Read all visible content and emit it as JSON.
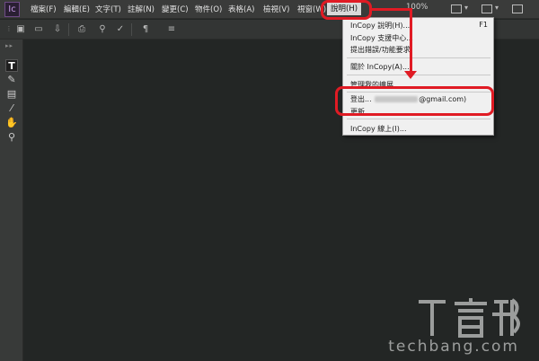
{
  "app": {
    "logo_text": "Ic"
  },
  "menubar": {
    "items": [
      {
        "label": "檔案(F)"
      },
      {
        "label": "編輯(E)"
      },
      {
        "label": "文字(T)"
      },
      {
        "label": "註解(N)"
      },
      {
        "label": "變更(C)"
      },
      {
        "label": "物件(O)"
      },
      {
        "label": "表格(A)"
      },
      {
        "label": "檢視(V)"
      },
      {
        "label": "視窗(W)"
      },
      {
        "label": "說明(H)"
      }
    ],
    "zoom": "100%"
  },
  "tools": [
    {
      "name": "type-tool-icon",
      "glyph": "T"
    },
    {
      "name": "note-tool-icon",
      "glyph": "✎"
    },
    {
      "name": "position-tool-icon",
      "glyph": "▤"
    },
    {
      "name": "eyedropper-tool-icon",
      "glyph": "⁄"
    },
    {
      "name": "hand-tool-icon",
      "glyph": "✋"
    },
    {
      "name": "zoom-tool-icon",
      "glyph": "⚲"
    }
  ],
  "help_menu": {
    "items": [
      {
        "label": "InCopy 說明(H)...",
        "shortcut": "F1"
      },
      {
        "label": "InCopy 支援中心..."
      },
      {
        "label": "提出錯誤/功能要求"
      },
      {
        "label": "關於 InCopy(A)..."
      },
      {
        "label": "管理我的擴展"
      },
      {
        "label_prefix": "登出...",
        "label_suffix": "@gmail.com)"
      },
      {
        "label": "更新..."
      },
      {
        "label": "InCopy 線上(I)..."
      }
    ]
  },
  "watermark": {
    "text": "techbang.com"
  },
  "colors": {
    "annotation_red": "#e01b24",
    "menu_bg": "#f0f0f0",
    "workspace": "#232625"
  }
}
